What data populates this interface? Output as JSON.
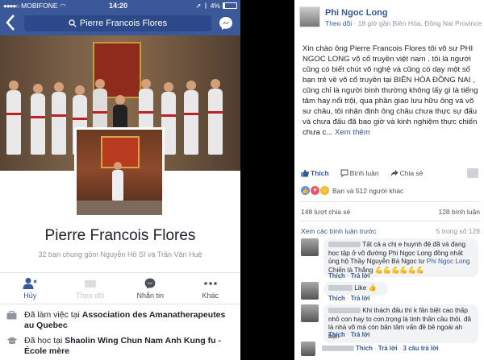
{
  "status_bar": {
    "carrier": "MOBIFONE",
    "time": "14:20",
    "battery": "4%"
  },
  "nav": {
    "search_text": "Pierre Francois Flores"
  },
  "profile": {
    "name": "Pierre Francois Flores",
    "mutual_text": "32 bạn chung gồm Nguyễn Hồ Sĩ và Trần Văn Huệ"
  },
  "actions": [
    {
      "label": "Hủy",
      "icon": "person-cancel-icon"
    },
    {
      "label": "Theo dõi",
      "icon": "follow-icon"
    },
    {
      "label": "Nhắn tin",
      "icon": "messenger-icon"
    },
    {
      "label": "Khác",
      "icon": "more-icon"
    }
  ],
  "info": {
    "work_prefix": "Đã làm việc tại ",
    "work_place": "Association des Amanatherapeutes au Quebec",
    "study_prefix": "Đã học tại ",
    "study_place": "Shaolin Wing Chun Nam Anh Kung fu - École mère"
  },
  "post": {
    "author": "Phi Ngoc Long",
    "follow_label": "Theo dõi",
    "meta": " · 18 giờ gần Biên Hòa, Đồng Nai Province",
    "body": "Xin chào ông Pierre Francois Flores tôi võ sư PHI NGOC LONG võ cổ truyền việt nam . tôi là người cũng có biết chút võ nghệ và cũng có dạy một số bạn trẻ về võ cổ truyền tại BIÊN HÒA ĐỒNG NAI , cũng chỉ là người bình thường không lấy gì là tiếng tăm hay nổi trội, qua phần giao lưu hữu ông và võ sư châu, tôi nhận định ông châu chưa thực sự đấu và chưa đấu đã bao giờ và kinh nghiệm thực chiến chưa c...",
    "see_more": "Xem thêm",
    "like_label": "Thích",
    "comment_label": "Bình luận",
    "share_label": "Chia sẻ",
    "reactions_text": "Bạn và 512 người khác",
    "shares_count": "148 lượt chia sẻ",
    "comments_count": "128 bình luận",
    "prev_comments": "Xem các bình luận trước",
    "prev_count": "5 trong số 128"
  },
  "comments": [
    {
      "text": "Tất cả a chị e huynh đệ đã và đang học tập ở võ đường Phi Ngọc Long đồng nhất ủng hộ Thầy Nguyễn Bá Ngọc tư ",
      "link": "Phi Ngọc Long",
      "text2": " Chiến là Thắng",
      "emojis": "💪💪💪💪💪💪",
      "meta_like": "Thích",
      "meta_reply": "Trả lời"
    },
    {
      "text": "Like ",
      "emojis": "👍",
      "meta_like": "Thích",
      "meta_reply": "Trả lời"
    },
    {
      "text": "Khi thách đấu thì k fân biệt cao thấp nhỏ con hay to con.trọng là tinh thần cầu thôi. đã là nhà võ mà còn bận tâm vấn đề bề ngoài ah bạn",
      "meta_like": "Thích",
      "meta_reply": "Trả lời"
    },
    {
      "text": "",
      "meta_like": "Thích",
      "meta_reply": "Trả lời",
      "meta_extra": "3 câu trả lời"
    }
  ]
}
